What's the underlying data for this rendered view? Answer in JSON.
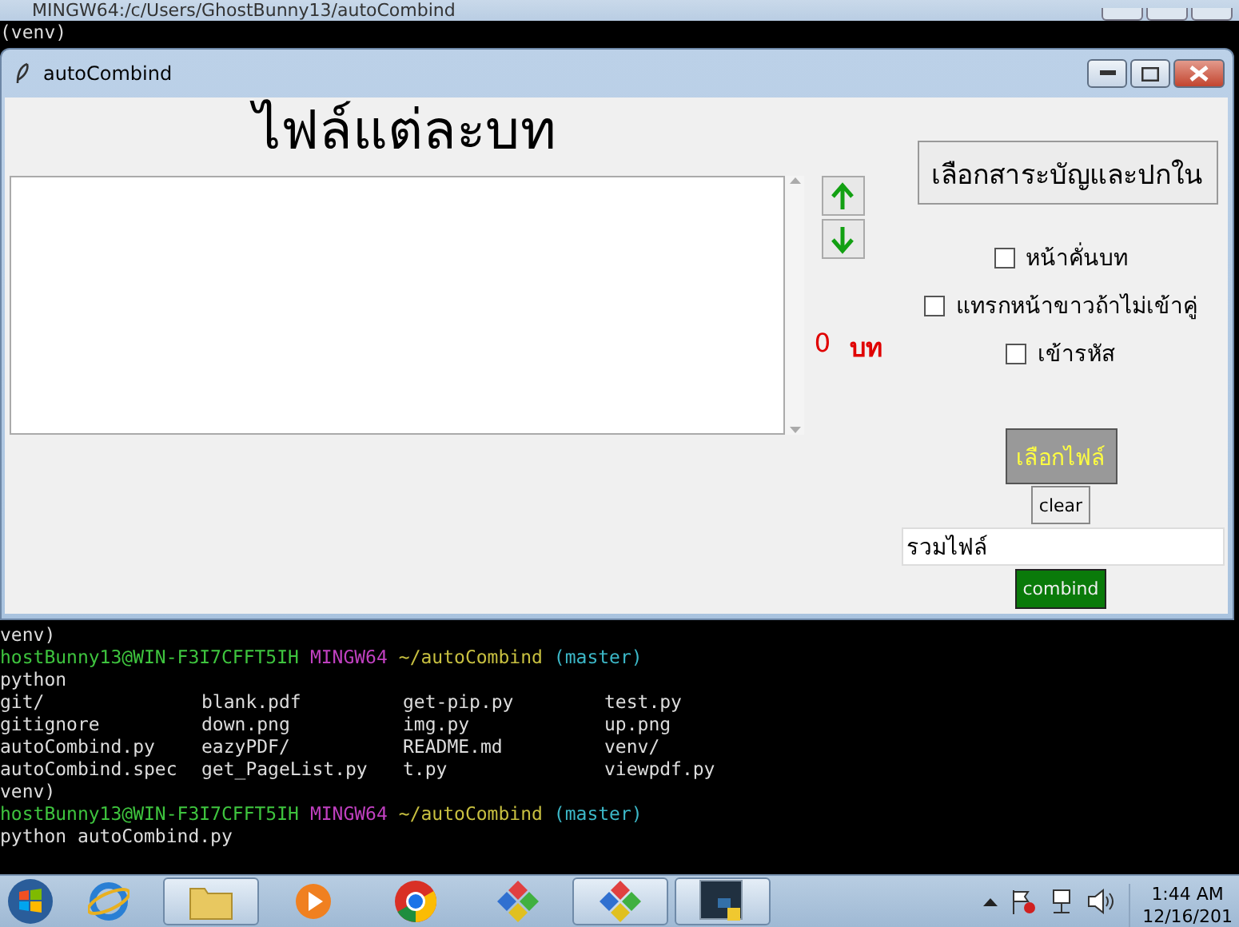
{
  "terminal_window": {
    "title": "MINGW64:/c/Users/GhostBunny13/autoCombind",
    "lines_above": [
      "(venv)"
    ]
  },
  "app_window": {
    "title": "autoCombind",
    "heading": "ไฟล์แต่ละบท",
    "move_buttons": [
      {
        "kind": "up"
      },
      {
        "kind": "down"
      }
    ],
    "count": {
      "value": "0",
      "unit": "บท"
    },
    "toc_button": "เลือกสาระบัญและปกใน",
    "options": [
      {
        "label": "หน้าคั่นบท",
        "checked": false
      },
      {
        "label": "แทรกหน้าขาวถ้าไม่เข้าคู่",
        "checked": false
      },
      {
        "label": "เข้ารหัส",
        "checked": false
      }
    ],
    "choose_files_button": "เลือกไฟล์",
    "clear_button": "clear",
    "output_name": {
      "value": "รวมไฟล์"
    },
    "combine_button": "combind"
  },
  "terminal": [
    {
      "kind": "plain",
      "text": "venv)"
    },
    {
      "kind": "prompt",
      "user": "hostBunny13@WIN-F3I7CFFT5IH",
      "system": "MINGW64",
      "path": "~/autoCombind",
      "branch": "(master)"
    },
    {
      "kind": "plain",
      "text": "python"
    },
    {
      "kind": "listing",
      "cells": [
        "git/",
        "blank.pdf",
        "get-pip.py",
        "test.py"
      ]
    },
    {
      "kind": "listing",
      "cells": [
        "gitignore",
        "down.png",
        "img.py",
        "up.png"
      ]
    },
    {
      "kind": "listing",
      "cells": [
        "autoCombind.py",
        "eazyPDF/",
        "README.md",
        "venv/"
      ]
    },
    {
      "kind": "listing",
      "cells": [
        "autoCombind.spec",
        "get_PageList.py",
        "t.py",
        "viewpdf.py"
      ]
    },
    {
      "kind": "plain",
      "text": "venv)"
    },
    {
      "kind": "prompt",
      "user": "hostBunny13@WIN-F3I7CFFT5IH",
      "system": "MINGW64",
      "path": "~/autoCombind",
      "branch": "(master)"
    },
    {
      "kind": "plain",
      "text": "python autoCombind.py"
    }
  ],
  "taskbar": {
    "items": [
      {
        "kind": "browser",
        "active": false
      },
      {
        "kind": "folder",
        "active": true
      },
      {
        "kind": "media",
        "active": false
      },
      {
        "kind": "chrome",
        "active": false
      },
      {
        "kind": "git",
        "active": false
      },
      {
        "kind": "git",
        "active": true
      },
      {
        "kind": "python",
        "active": true
      }
    ],
    "clock": {
      "time": "1:44 AM",
      "date": "12/16/201"
    }
  }
}
